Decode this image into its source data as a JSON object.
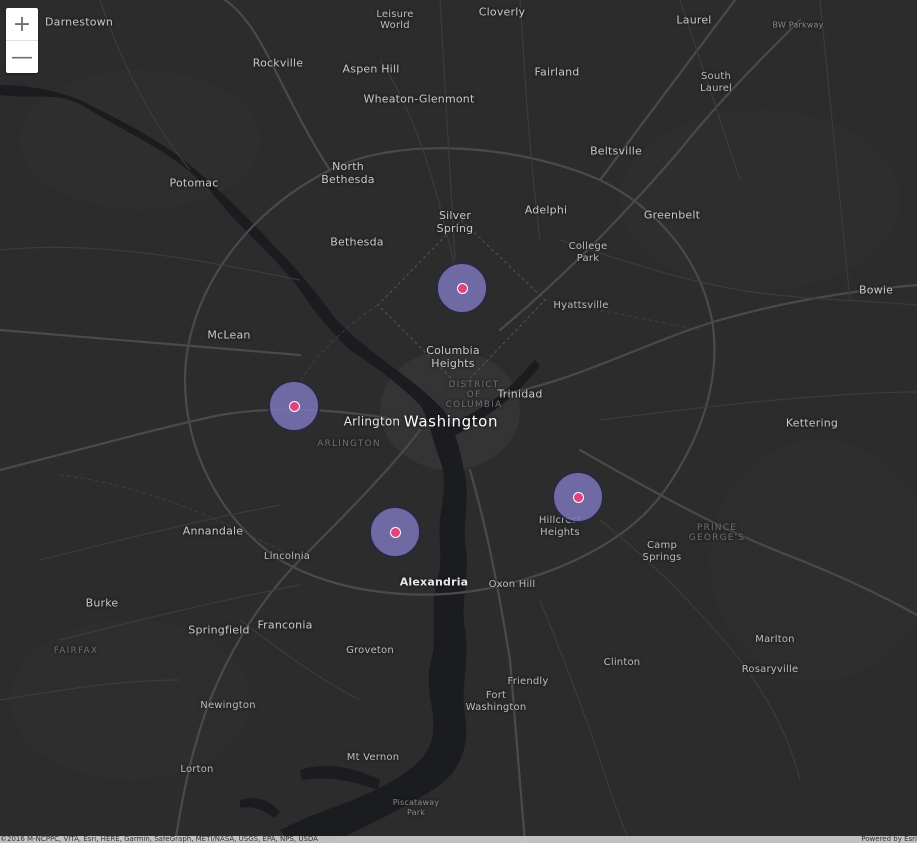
{
  "zoom": {
    "in_label": "+",
    "out_label": "—"
  },
  "labels": {
    "darnestown": "Darnestown",
    "leisure_world": "Leisure\nWorld",
    "cloverly": "Cloverly",
    "laurel": "Laurel",
    "bw_parkway": "BW Parkway",
    "rockville": "Rockville",
    "aspen_hill": "Aspen Hill",
    "fairland": "Fairland",
    "south_laurel": "South\nLaurel",
    "wheaton_glenmont": "Wheaton-Glenmont",
    "beltsville": "Beltsville",
    "potomac": "Potomac",
    "north_bethesda": "North\nBethesda",
    "silver_spring": "Silver\nSpring",
    "adelphi": "Adelphi",
    "greenbelt": "Greenbelt",
    "bethesda": "Bethesda",
    "college_park": "College\nPark",
    "bowie": "Bowie",
    "hyattsville": "Hyattsville",
    "mclean": "McLean",
    "columbia_heights": "Columbia\nHeights",
    "district_of_columbia": "DISTRICT\nOF\nCOLUMBIA",
    "trinidad": "Trinidad",
    "arlington": "Arlington",
    "washington": "Washington",
    "arlington_region": "ARLINGTON",
    "kettering": "Kettering",
    "hillcrest_heights": "Hillcrest\nHeights",
    "prince_georges": "PRINCE\nGEORGE'S",
    "annandale": "Annandale",
    "camp_springs": "Camp\nSprings",
    "lincolnia": "Lincolnia",
    "alexandria": "Alexandria",
    "oxon_hill": "Oxon Hill",
    "burke": "Burke",
    "springfield": "Springfield",
    "franconia": "Franconia",
    "marlton": "Marlton",
    "fairfax": "FAIRFAX",
    "groveton": "Groveton",
    "clinton": "Clinton",
    "rosaryville": "Rosaryville",
    "friendly": "Friendly",
    "fort_washington": "Fort\nWashington",
    "newington": "Newington",
    "mt_vernon": "Mt Vernon",
    "lorton": "Lorton",
    "piscataway_park": "Piscataway\nPark"
  },
  "attribution": {
    "left": "©2016 M-NCPPC, VITA, Esri, HERE, Garmin, SafeGraph, METI/NASA, USGS, EPA, NPS, USDA",
    "right": "Powered by Esri"
  },
  "colors": {
    "background": "#2c2c2c",
    "marker_fill": "#7b76b8",
    "marker_dot": "#e0447e",
    "water": "#1a1c20"
  }
}
